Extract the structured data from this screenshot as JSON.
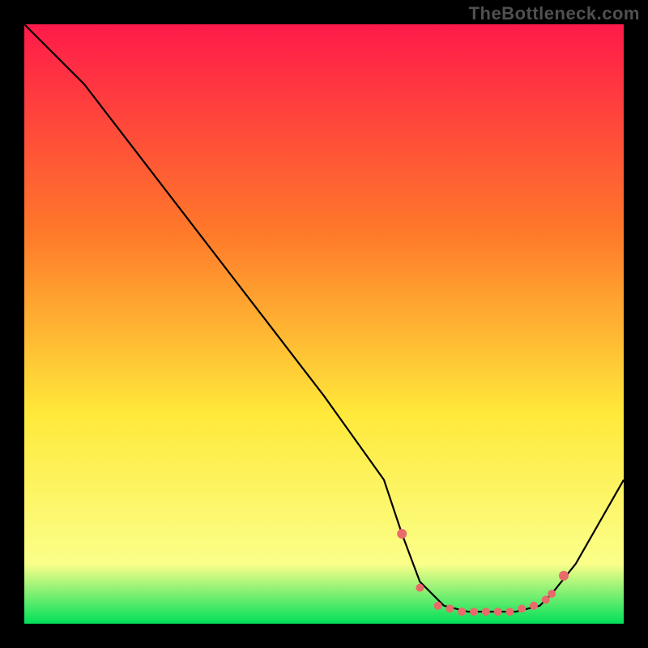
{
  "watermark": "TheBottleneck.com",
  "colors": {
    "gradient_top": "#ff1a4a",
    "gradient_mid1": "#ff7a2a",
    "gradient_mid2": "#ffe93a",
    "gradient_low": "#fbff8a",
    "gradient_bottom": "#00e05a",
    "curve": "#000000",
    "markers": "#e96a6a"
  },
  "chart_data": {
    "type": "line",
    "title": "",
    "xlabel": "",
    "ylabel": "",
    "xlim": [
      0,
      100
    ],
    "ylim": [
      0,
      100
    ],
    "series": [
      {
        "name": "curve",
        "x": [
          0,
          6,
          10,
          20,
          30,
          40,
          50,
          60,
          63,
          66,
          70,
          74,
          78,
          82,
          86,
          88,
          92,
          100
        ],
        "y": [
          100,
          94,
          90,
          77,
          64,
          51,
          38,
          24,
          15,
          7,
          3,
          2,
          2,
          2,
          3,
          5,
          10,
          24
        ]
      }
    ],
    "markers": {
      "name": "highlight-points",
      "x": [
        63,
        66,
        69,
        71,
        73,
        75,
        77,
        79,
        81,
        83,
        85,
        87,
        88,
        90
      ],
      "y": [
        15,
        6,
        3,
        2.5,
        2,
        2,
        2,
        2,
        2,
        2.5,
        3,
        4,
        5,
        8
      ]
    }
  }
}
